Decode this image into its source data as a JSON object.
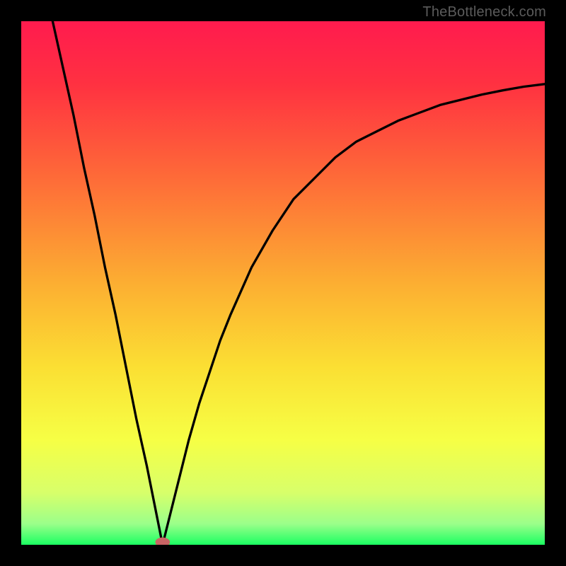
{
  "watermark": "TheBottleneck.com",
  "colors": {
    "frame": "#000000",
    "curve": "#000000",
    "minMarker": "#C86464",
    "gradientStops": [
      {
        "offset": 0.0,
        "color": "#FF1B4E"
      },
      {
        "offset": 0.12,
        "color": "#FF3141"
      },
      {
        "offset": 0.3,
        "color": "#FE6B38"
      },
      {
        "offset": 0.5,
        "color": "#FCAE32"
      },
      {
        "offset": 0.66,
        "color": "#FBDF33"
      },
      {
        "offset": 0.8,
        "color": "#F6FF45"
      },
      {
        "offset": 0.9,
        "color": "#D8FF6A"
      },
      {
        "offset": 0.96,
        "color": "#9BFF8A"
      },
      {
        "offset": 1.0,
        "color": "#1BFF62"
      }
    ]
  },
  "chart_data": {
    "type": "line",
    "title": "",
    "xlabel": "",
    "ylabel": "",
    "xlim": [
      0,
      100
    ],
    "ylim": [
      0,
      100
    ],
    "curve": {
      "minimum_x": 27,
      "points": [
        {
          "x": 6,
          "y": 100
        },
        {
          "x": 8,
          "y": 91
        },
        {
          "x": 10,
          "y": 82
        },
        {
          "x": 12,
          "y": 72
        },
        {
          "x": 14,
          "y": 63
        },
        {
          "x": 16,
          "y": 53
        },
        {
          "x": 18,
          "y": 44
        },
        {
          "x": 20,
          "y": 34
        },
        {
          "x": 22,
          "y": 24
        },
        {
          "x": 24,
          "y": 15
        },
        {
          "x": 26,
          "y": 5
        },
        {
          "x": 27,
          "y": 0
        },
        {
          "x": 28,
          "y": 4
        },
        {
          "x": 30,
          "y": 12
        },
        {
          "x": 32,
          "y": 20
        },
        {
          "x": 34,
          "y": 27
        },
        {
          "x": 36,
          "y": 33
        },
        {
          "x": 38,
          "y": 39
        },
        {
          "x": 40,
          "y": 44
        },
        {
          "x": 44,
          "y": 53
        },
        {
          "x": 48,
          "y": 60
        },
        {
          "x": 52,
          "y": 66
        },
        {
          "x": 56,
          "y": 70
        },
        {
          "x": 60,
          "y": 74
        },
        {
          "x": 64,
          "y": 77
        },
        {
          "x": 68,
          "y": 79
        },
        {
          "x": 72,
          "y": 81
        },
        {
          "x": 76,
          "y": 82.5
        },
        {
          "x": 80,
          "y": 84
        },
        {
          "x": 84,
          "y": 85
        },
        {
          "x": 88,
          "y": 86
        },
        {
          "x": 92,
          "y": 86.8
        },
        {
          "x": 96,
          "y": 87.5
        },
        {
          "x": 100,
          "y": 88
        }
      ]
    },
    "marker": {
      "x": 27,
      "y": 0,
      "rx": 1.4,
      "ry": 0.9
    }
  }
}
